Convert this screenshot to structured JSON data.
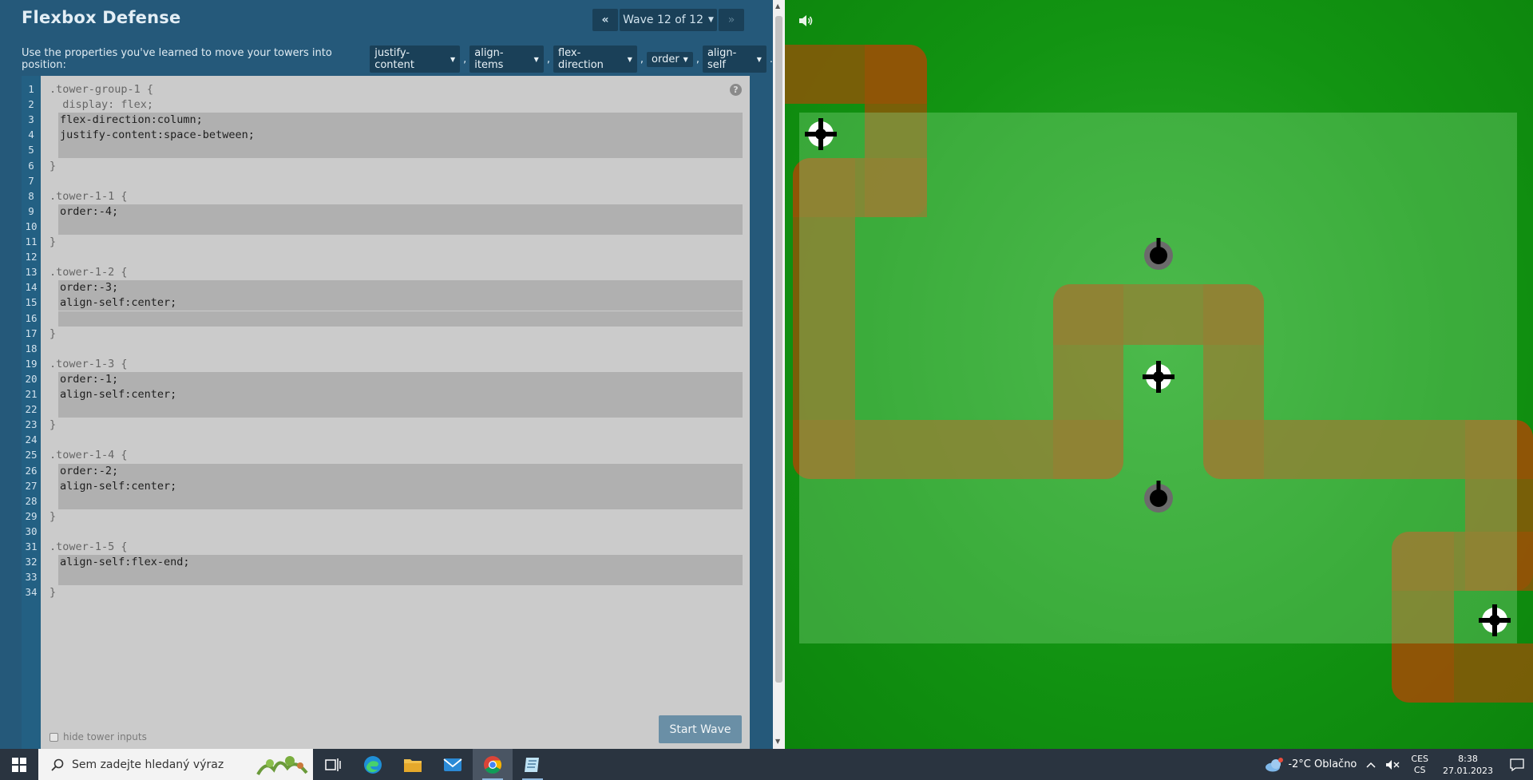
{
  "app": {
    "title": "Flexbox Defense",
    "wave_label": "Wave 12 of 12",
    "prev_label": "«",
    "next_label": "»",
    "instructions": "Use the properties you've learned to move your towers into position:",
    "properties": [
      "justify-content",
      "align-items",
      "flex-direction",
      "order",
      "align-self"
    ],
    "help_label": "?",
    "hide_inputs_label": "hide tower inputs",
    "start_label": "Start Wave"
  },
  "editor": {
    "lines": [
      {
        "n": "1",
        "text": ".tower-group-1 {",
        "type": "code"
      },
      {
        "n": "2",
        "text": "  display: flex;",
        "type": "code"
      },
      {
        "n": "3",
        "text": "flex-direction:column;",
        "type": "input"
      },
      {
        "n": "4",
        "text": "justify-content:space-between;",
        "type": "input"
      },
      {
        "n": "5",
        "text": "",
        "type": "input"
      },
      {
        "n": "6",
        "text": "}",
        "type": "code"
      },
      {
        "n": "7",
        "text": "",
        "type": "code"
      },
      {
        "n": "8",
        "text": ".tower-1-1 {",
        "type": "code"
      },
      {
        "n": "9",
        "text": "order:-4;",
        "type": "input"
      },
      {
        "n": "10",
        "text": "",
        "type": "input"
      },
      {
        "n": "11",
        "text": "}",
        "type": "code"
      },
      {
        "n": "12",
        "text": "",
        "type": "code"
      },
      {
        "n": "13",
        "text": ".tower-1-2 {",
        "type": "code"
      },
      {
        "n": "14",
        "text": "order:-3;",
        "type": "input"
      },
      {
        "n": "15",
        "text": "align-self:center;",
        "type": "input"
      },
      {
        "n": "16",
        "text": "",
        "type": "input"
      },
      {
        "n": "17",
        "text": "}",
        "type": "code"
      },
      {
        "n": "18",
        "text": "",
        "type": "code"
      },
      {
        "n": "19",
        "text": ".tower-1-3 {",
        "type": "code"
      },
      {
        "n": "20",
        "text": "order:-1;",
        "type": "input"
      },
      {
        "n": "21",
        "text": "align-self:center;",
        "type": "input"
      },
      {
        "n": "22",
        "text": "",
        "type": "input"
      },
      {
        "n": "23",
        "text": "}",
        "type": "code"
      },
      {
        "n": "24",
        "text": "",
        "type": "code"
      },
      {
        "n": "25",
        "text": ".tower-1-4 {",
        "type": "code"
      },
      {
        "n": "26",
        "text": "order:-2;",
        "type": "input"
      },
      {
        "n": "27",
        "text": "align-self:center;",
        "type": "input"
      },
      {
        "n": "28",
        "text": "",
        "type": "input"
      },
      {
        "n": "29",
        "text": "}",
        "type": "code"
      },
      {
        "n": "30",
        "text": "",
        "type": "code"
      },
      {
        "n": "31",
        "text": ".tower-1-5 {",
        "type": "code"
      },
      {
        "n": "32",
        "text": "align-self:flex-end;",
        "type": "input"
      },
      {
        "n": "33",
        "text": "",
        "type": "input"
      },
      {
        "n": "34",
        "text": "}",
        "type": "code"
      }
    ]
  },
  "game": {
    "towers": [
      {
        "name": "tower-crosshair",
        "icon": "crosshair-tower-icon"
      },
      {
        "name": "tower-cannon",
        "icon": "cannon-tower-icon"
      },
      {
        "name": "tower-crosshair",
        "icon": "crosshair-tower-icon"
      },
      {
        "name": "tower-cannon",
        "icon": "cannon-tower-icon"
      },
      {
        "name": "tower-crosshair",
        "icon": "crosshair-tower-icon"
      }
    ]
  },
  "taskbar": {
    "search_placeholder": "Sem zadejte hledaný výraz",
    "weather": "-2°C  Oblačno",
    "lang_top": "CES",
    "lang_bottom": "CS",
    "time": "8:38",
    "date": "27.01.2023"
  }
}
